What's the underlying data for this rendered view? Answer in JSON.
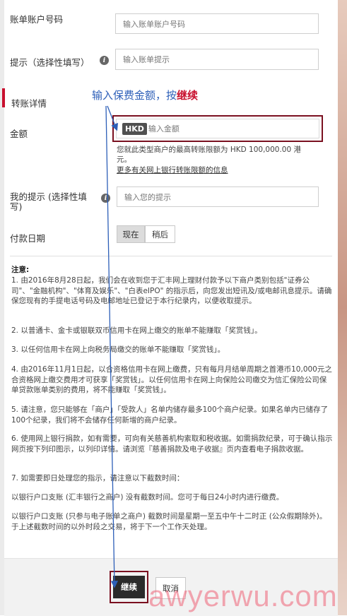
{
  "form": {
    "account_label": "账单账户号码",
    "account_placeholder": "输入账单账户号码",
    "hint_label": "提示（选择性填写）",
    "hint_placeholder": "输入账单提示",
    "section_title": "转账详情",
    "annotation_prefix": "输入保费金额，按",
    "annotation_emphasis": "继续",
    "amount_label": "金额",
    "currency": "HKD",
    "amount_placeholder": "输入金额",
    "limit_text_1": "您就此类型商户的最高转账限额为 HKD 100,000.00 港",
    "limit_text_2": "元。",
    "limit_link": "更多有关网上银行转账限额的信息",
    "my_hint_label_1": "我的提示 (选择性填",
    "my_hint_label_2": "写)",
    "my_hint_placeholder": "输入您的提示",
    "date_label": "付款日期",
    "date_now": "现在",
    "date_later": "稍后"
  },
  "notes": {
    "title": "注意:",
    "n1": "1. 由2016年8月28日起，我们会在收到您于汇丰网上理财付款予以下商户类别包括\"证券公司\"、\"金融机构\"、\"体育及娱乐\"、\"白表eIPO\" 的指示后，向您发出短讯及/或电邮讯息提示。请确保您现有的手提电话号码及电邮地址已登记于本行纪录内，以便收取提示。",
    "n2": "2. 以普通卡、金卡或银联双币信用卡在网上缴交的账单不能赚取「奖赏钱」。",
    "n3": "3. 以任何信用卡在网上向税务局缴交的账单不能赚取「奖赏钱」。",
    "n4": "4. 由2016年11月1日起，以合资格信用卡在网上缴费，只有每月月结单周期之首港币10,000元之合资格网上缴交费用才可获享「奖赏钱」。以任何信用卡在网上向保险公司缴交为信汇保险公司保单贷款账单类别的费用，将不能赚取「奖赏钱」。",
    "n5": "5. 请注意，您只能够在「商户」「受款人」名单内储存最多100个商户纪录。如果名单内已储存了100个纪录，我们将不会储存任何新增的商户纪录。",
    "n6": "6. 使用网上银行捐款，如有需要，可向有关慈善机构索取和税收据。如需捐款纪录，可于确认指示网页按下列印图示，以列印详情。请浏览『慈善捐款及电子收据』页内查看电子捐款收据。",
    "n7": "7. 如需要即日处理您的指示，请注意以下截数时间：",
    "n8": "以银行户口支账 (汇丰银行之商户) 没有截数时间。您可于每日24小时内进行缴费。",
    "n9": "以银行户口支账 (只参与电子账单之商户) 截数时间是星期一至五中午十二时正 (公众假期除外)。于上述截数时间的以外时段之交易，将于下一个工作天处理。"
  },
  "buttons": {
    "continue": "继续",
    "cancel": "取消"
  },
  "watermark": "awyerwu.com",
  "colors": {
    "accent_red": "#c8102e",
    "annotation_blue": "#2d5fb8",
    "highlight_border": "#7a1020",
    "continue_bg": "#2b2b2b",
    "watermark": "#f06478"
  }
}
